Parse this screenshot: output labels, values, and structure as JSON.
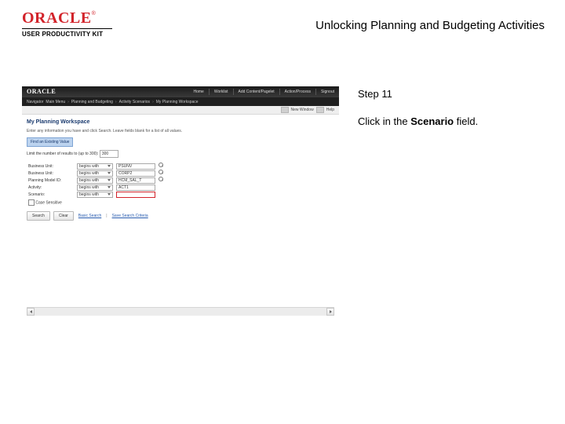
{
  "header": {
    "brand": "ORACLE",
    "tm": "®",
    "sub": "USER PRODUCTIVITY KIT",
    "doc_title": "Unlocking Planning and Budgeting Activities"
  },
  "instruction": {
    "step_label": "Step 11",
    "text_prefix": "Click in the ",
    "field_name": "Scenario",
    "text_suffix": " field."
  },
  "shot": {
    "brand": "ORACLE",
    "menu": [
      "Home",
      "Worklist",
      "Add Content/Pagelet",
      "Action/Process",
      "Signout"
    ],
    "breadcrumb": [
      "Navigator",
      "Main Menu",
      "Planning and Budgeting",
      "Activity Scenarios",
      "My Planning Workspace"
    ],
    "subbar": {
      "new_window": "New Window",
      "help": "Help"
    },
    "page_title": "My Planning Workspace",
    "hint": "Enter any information you have and click Search. Leave fields blank for a list of all values.",
    "chip": "Find an Existing Value",
    "limit_label": "Limit the number of results to (up to 300):",
    "limit_value": "300",
    "fields": [
      {
        "label": "Business Unit:",
        "op": "begins with",
        "value": "PSUNV",
        "lookup": true
      },
      {
        "label": "Business Unit:",
        "op": "begins with",
        "value": "CORP2",
        "lookup": true
      },
      {
        "label": "Planning Model ID:",
        "op": "begins with",
        "value": "HCM_SAL_T",
        "lookup": true
      },
      {
        "label": "Activity:",
        "op": "begins with",
        "value": "ACT1",
        "lookup": false
      },
      {
        "label": "Scenario:",
        "op": "begins with",
        "value": "",
        "lookup": false,
        "highlight": true
      }
    ],
    "case_label": "Case Sensitive",
    "buttons": {
      "search": "Search",
      "clear": "Clear"
    },
    "links": {
      "basic": "Basic Search",
      "save": "Save Search Criteria"
    }
  }
}
